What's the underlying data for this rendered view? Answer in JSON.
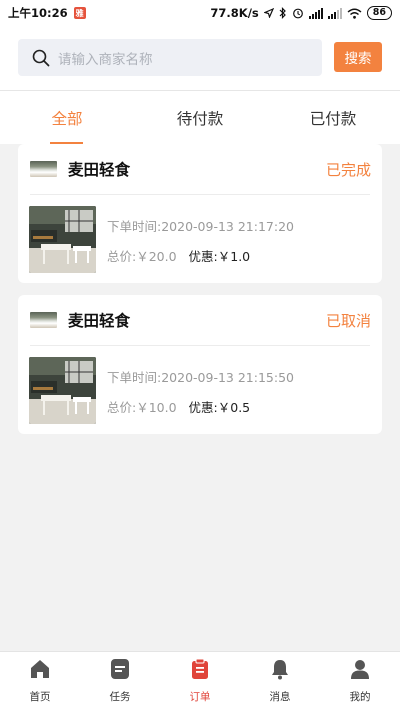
{
  "status_bar": {
    "time": "上午10:26",
    "notification_badge": "雅",
    "network_speed": "77.8K/s",
    "battery": "86"
  },
  "search": {
    "placeholder": "请输入商家名称",
    "button_label": "搜索"
  },
  "tabs": [
    {
      "label": "全部",
      "active": true
    },
    {
      "label": "待付款",
      "active": false
    },
    {
      "label": "已付款",
      "active": false
    }
  ],
  "orders": [
    {
      "shop_name": "麦田轻食",
      "status": "已完成",
      "order_time": "下单时间:2020-09-13 21:17:20",
      "total_price": "总价:￥20.0",
      "discount": "优惠:￥1.0"
    },
    {
      "shop_name": "麦田轻食",
      "status": "已取消",
      "order_time": "下单时间:2020-09-13 21:15:50",
      "total_price": "总价:￥10.0",
      "discount": "优惠:￥0.5"
    }
  ],
  "bottom_nav": [
    {
      "label": "首页",
      "icon": "home-icon",
      "active": false
    },
    {
      "label": "任务",
      "icon": "task-icon",
      "active": false
    },
    {
      "label": "订单",
      "icon": "order-icon",
      "active": true
    },
    {
      "label": "消息",
      "icon": "bell-icon",
      "active": false
    },
    {
      "label": "我的",
      "icon": "user-icon",
      "active": false
    }
  ],
  "colors": {
    "accent": "#f3823f",
    "nav_active": "#e0443a",
    "nav_inactive_icon": "#555555",
    "background": "#f2f2f2"
  }
}
